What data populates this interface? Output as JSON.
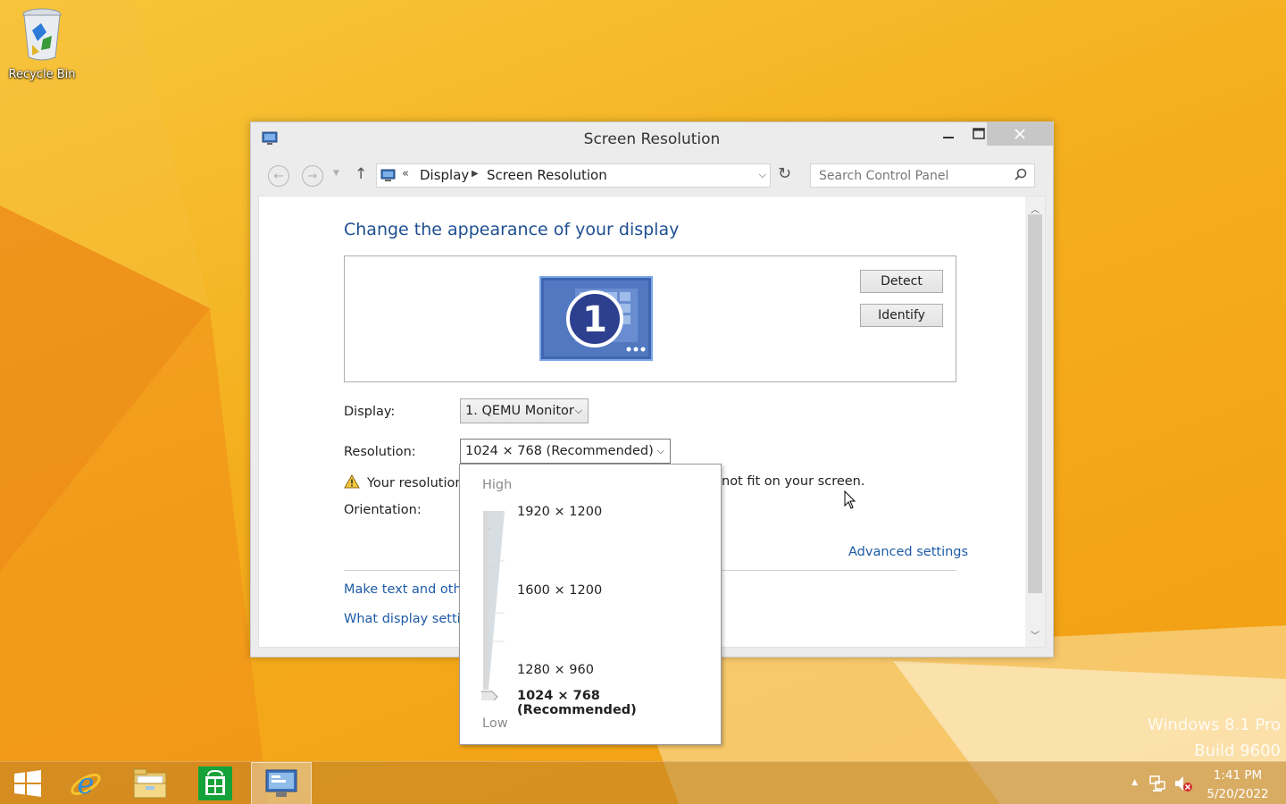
{
  "desktop": {
    "recycle_bin_label": "Recycle Bin",
    "watermark_line1": "Windows 8.1 Pro",
    "watermark_line2": "Build 9600"
  },
  "window": {
    "title": "Screen Resolution",
    "minimize_icon": "minimize-icon",
    "maximize_icon": "maximize-icon",
    "close_icon": "close-icon"
  },
  "nav": {
    "breadcrumb_prefix": "«",
    "breadcrumb": [
      "Display",
      "Screen Resolution"
    ],
    "search_placeholder": "Search Control Panel"
  },
  "main": {
    "heading": "Change the appearance of your display",
    "monitor_number": "1",
    "detect_label": "Detect",
    "identify_label": "Identify",
    "display_label": "Display:",
    "display_value": "1. QEMU Monitor",
    "resolution_label": "Resolution:",
    "resolution_value": "1024 × 768 (Recommended)",
    "warning_start": "Your resolution",
    "warning_end": "not fit on your screen.",
    "orientation_label": "Orientation:",
    "advanced_link": "Advanced settings",
    "link_make_text": "Make text and othe",
    "link_what_display": "What display setting"
  },
  "resolution_dropdown": {
    "high_label": "High",
    "low_label": "Low",
    "options": [
      {
        "label": "1920 × 1200",
        "selected": false
      },
      {
        "label": "1600 × 1200",
        "selected": false
      },
      {
        "label": "1280 × 960",
        "selected": false
      },
      {
        "label": "1024 × 768 (Recommended)",
        "selected": true
      }
    ]
  },
  "taskbar": {
    "clock_time": "1:41 PM",
    "clock_date": "5/20/2022"
  },
  "colors": {
    "wallpaper": "#f4ae1c",
    "heading_blue": "#1e4f91",
    "link_blue": "#1e5ba6",
    "close_button": "#c7c7c7"
  }
}
